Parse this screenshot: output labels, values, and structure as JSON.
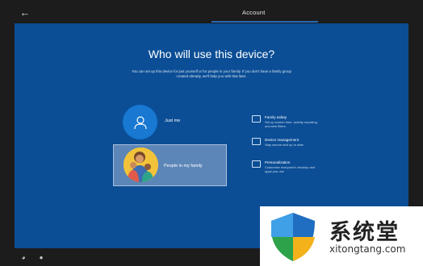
{
  "window": {
    "title": "Account"
  },
  "main": {
    "heading": "Who will use this device?",
    "subtext": "You can set up this device for just yourself or for people in your family. If you don't have a family group created already, we'll help you with that later."
  },
  "options": [
    {
      "label": "Just me",
      "icon": "user-icon"
    },
    {
      "label": "People in my family",
      "icon": "family-icon"
    }
  ],
  "features": [
    {
      "title": "Family safety",
      "description": "Set up screen time, activity reporting, and web filters",
      "icon": "family-safety-icon"
    },
    {
      "title": "Device management",
      "description": "Stay secure and up to date",
      "icon": "device-management-icon"
    },
    {
      "title": "Personalization",
      "description": "Customize everyone's desktop and apps you use",
      "icon": "personalization-icon"
    }
  ],
  "watermark": {
    "name": "系统堂",
    "url": "xitongtang.com"
  },
  "colors": {
    "panel": "#0b4e96",
    "accent": "#1878d2",
    "selected": "#5d86b8"
  }
}
